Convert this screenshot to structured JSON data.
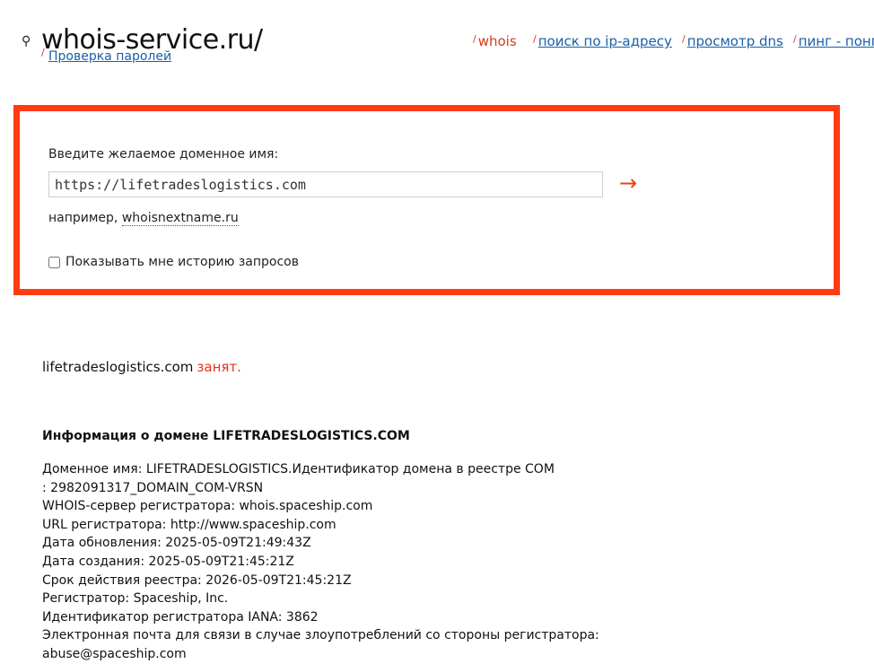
{
  "header": {
    "logo_icon": "⚲",
    "logo_text": "whois-service.ru/",
    "sublink_tick": "/",
    "sublink": "Проверка паролей"
  },
  "nav": {
    "tick": "/",
    "items": [
      {
        "label": "whois",
        "current": true
      },
      {
        "label": "поиск по ip-адресу",
        "current": false
      },
      {
        "label": "просмотр dns",
        "current": false
      },
      {
        "label": "пинг - понг",
        "current": false
      }
    ]
  },
  "search": {
    "prompt": "Введите желаемое доменное имя:",
    "value": "https://lifetradeslogistics.com",
    "submit_arrow": "→",
    "example_prefix": "например,",
    "example_domain": "whoisnextname.ru",
    "history_label": "Показывать мне историю запросов",
    "history_checked": false
  },
  "result": {
    "domain": "lifetradeslogistics.com",
    "status": "занят."
  },
  "info": {
    "title": "Информация о домене LIFETRADESLOGISTICS.COM",
    "lines": [
      "Доменное имя: LIFETRADESLOGISTICS.Идентификатор домена в реестре COM",
      ": 2982091317_DOMAIN_COM-VRSN",
      "WHOIS-сервер регистратора: whois.spaceship.com",
      "URL регистратора: http://www.spaceship.com",
      "Дата обновления: 2025-05-09T21:49:43Z",
      "Дата создания: 2025-05-09T21:45:21Z",
      "Срок действия реестра: 2026-05-09T21:45:21Z",
      "Регистратор: Spaceship, Inc.",
      "Идентификатор регистратора IANA: 3862",
      "Электронная почта для связи в случае злоупотреблений со стороны регистратора:",
      "abuse@spaceship.com"
    ]
  },
  "colors": {
    "accent_red": "#ff3b14",
    "link_blue": "#1a5fa8",
    "taken_red": "#e3341c"
  }
}
